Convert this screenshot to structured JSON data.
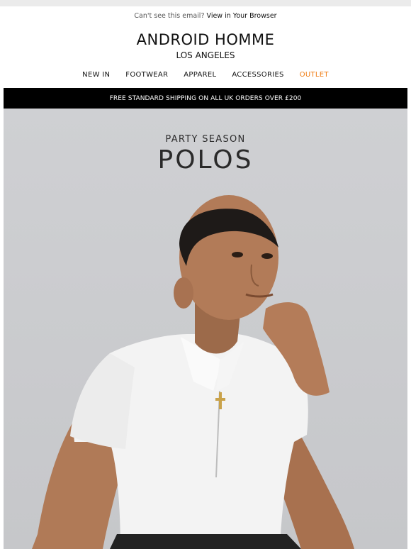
{
  "preheader": {
    "prefix": "Can't see this email?",
    "link": "View in Your Browser"
  },
  "brand": {
    "name": "ANDROID HOMME",
    "city": "LOS ANGELES"
  },
  "nav": {
    "items": [
      "NEW IN",
      "FOOTWEAR",
      "APPAREL",
      "ACCESSORIES",
      "OUTLET"
    ]
  },
  "shipping_banner": "FREE STANDARD SHIPPING ON ALL UK ORDERS OVER £200",
  "hero": {
    "eyebrow": "PARTY SEASON",
    "headline": "POLOS"
  },
  "colors": {
    "outlet": "#f07c12",
    "banner_bg": "#000000",
    "hero_bg": "#cfd0d3"
  }
}
